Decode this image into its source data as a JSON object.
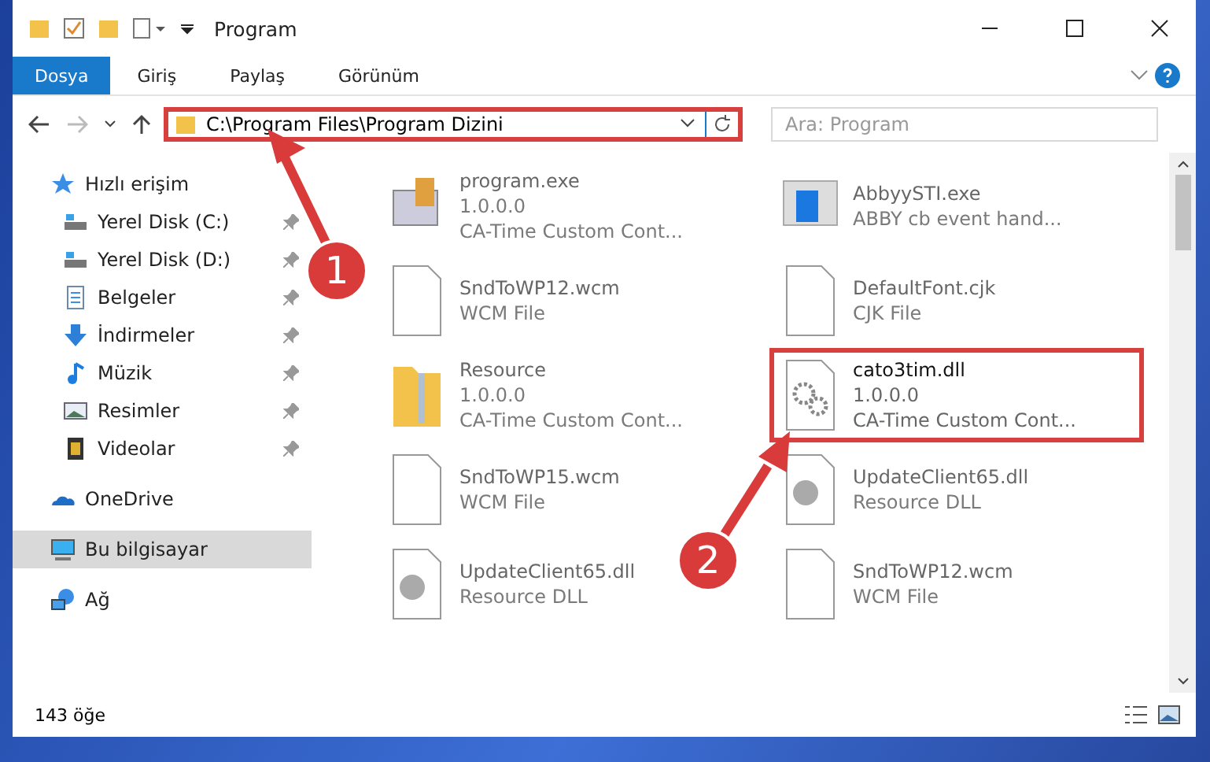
{
  "window": {
    "title": "Program"
  },
  "ribbon_tabs": [
    {
      "label": "Dosya",
      "selected": true
    },
    {
      "label": "Giriş",
      "selected": false
    },
    {
      "label": "Paylaş",
      "selected": false
    },
    {
      "label": "Görünüm",
      "selected": false
    }
  ],
  "address_bar": {
    "path": "C:\\Program Files\\Program Dizini",
    "highlighted": true
  },
  "search": {
    "placeholder": "Ara: Program"
  },
  "sidebar": {
    "items": [
      {
        "label": "Hızlı erişim",
        "kind": "star",
        "pinned": false,
        "selected": false,
        "children": [
          {
            "label": "Yerel Disk (C:)",
            "kind": "drive",
            "pinned": true,
            "selected": false
          },
          {
            "label": "Yerel Disk (D:)",
            "kind": "drive",
            "pinned": true,
            "selected": false
          },
          {
            "label": "Belgeler",
            "kind": "doc",
            "pinned": true,
            "selected": false
          },
          {
            "label": "İndirmeler",
            "kind": "download",
            "pinned": true,
            "selected": false
          },
          {
            "label": "Müzik",
            "kind": "music",
            "pinned": true,
            "selected": false
          },
          {
            "label": "Resimler",
            "kind": "picture",
            "pinned": true,
            "selected": false
          },
          {
            "label": "Videolar",
            "kind": "video",
            "pinned": true,
            "selected": false
          }
        ]
      },
      {
        "label": "OneDrive",
        "kind": "cloud",
        "pinned": false,
        "selected": false
      },
      {
        "label": "Bu bilgisayar",
        "kind": "pc",
        "pinned": false,
        "selected": true
      },
      {
        "label": "Ağ",
        "kind": "network",
        "pinned": false,
        "selected": false
      }
    ]
  },
  "files": [
    {
      "name": "program.exe",
      "details": [
        "1.0.0.0",
        "CA-Time Custom Cont..."
      ],
      "kind": "exe",
      "highlighted": false
    },
    {
      "name": "AbbyySTI.exe",
      "details": [
        "ABBY cb event hand..."
      ],
      "kind": "app",
      "highlighted": false
    },
    {
      "name": "SndToWP12.wcm",
      "details": [
        "WCM File"
      ],
      "kind": "blank",
      "highlighted": false
    },
    {
      "name": "DefaultFont.cjk",
      "details": [
        "CJK File"
      ],
      "kind": "blank",
      "highlighted": false
    },
    {
      "name": "Resource",
      "details": [
        "1.0.0.0",
        "CA-Time Custom Cont..."
      ],
      "kind": "folder",
      "highlighted": false
    },
    {
      "name": "cato3tim.dll",
      "details": [
        "1.0.0.0",
        "CA-Time Custom Cont..."
      ],
      "kind": "gears",
      "highlighted": true
    },
    {
      "name": "SndToWP15.wcm",
      "details": [
        "WCM File"
      ],
      "kind": "blank",
      "highlighted": false
    },
    {
      "name": "UpdateClient65.dll",
      "details": [
        "Resource DLL"
      ],
      "kind": "dll",
      "highlighted": false
    },
    {
      "name": "UpdateClient65.dll",
      "details": [
        "Resource DLL"
      ],
      "kind": "dll",
      "highlighted": false
    },
    {
      "name": "SndToWP12.wcm",
      "details": [
        "WCM File"
      ],
      "kind": "blank",
      "highlighted": false
    }
  ],
  "status_bar": {
    "count": "143 öğe"
  },
  "callouts": [
    {
      "number": "1"
    },
    {
      "number": "2"
    }
  ]
}
